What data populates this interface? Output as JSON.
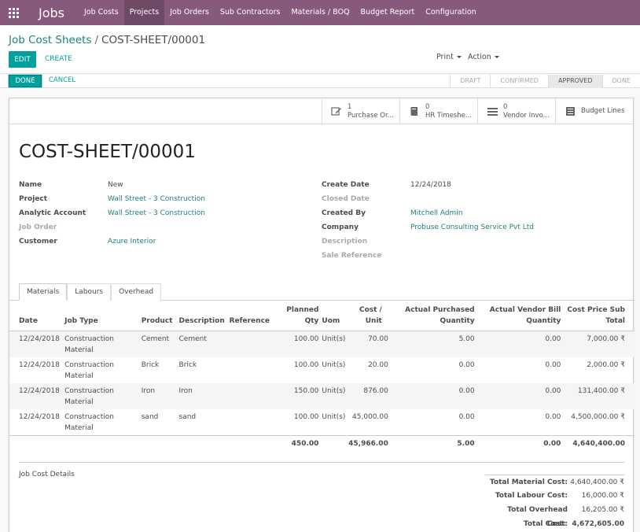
{
  "navbar": {
    "app_title": "Jobs",
    "menu": [
      "Job Costs",
      "Projects",
      "Job Orders",
      "Sub Contractors",
      "Materials / BOQ",
      "Budget Report",
      "Configuration"
    ],
    "active_menu": "Projects"
  },
  "control_panel": {
    "breadcrumb_parent": "Job Cost Sheets",
    "breadcrumb_separator": "/",
    "breadcrumb_current": "COST-SHEET/00001",
    "edit_label": "EDIT",
    "create_label": "CREATE",
    "print_label": "Print",
    "action_label": "Action"
  },
  "statusbar": {
    "done_label": "DONE",
    "cancel_label": "CANCEL",
    "stages": [
      "DRAFT",
      "CONFIRMED",
      "APPROVED",
      "DONE"
    ],
    "active_stage": "APPROVED"
  },
  "smart_buttons": [
    {
      "count": "1",
      "label": "Purchase Or...",
      "icon": "edit-icon"
    },
    {
      "count": "0",
      "label": "HR Timeshe...",
      "icon": "book-icon"
    },
    {
      "count": "0",
      "label": "Vendor Invo...",
      "icon": "list-icon"
    },
    {
      "count": "",
      "label": "Budget Lines",
      "icon": "ledger-icon"
    }
  ],
  "form": {
    "title": "COST-SHEET/00001",
    "left_fields": [
      {
        "label": "Name",
        "value": "New"
      },
      {
        "label": "Project",
        "value": "Wall Street - 3 Construction"
      },
      {
        "label": "Analytic Account",
        "value": "Wall Street - 3 Construction"
      },
      {
        "label": "Job Order",
        "value": ""
      },
      {
        "label": "Customer",
        "value": "Azure Interior"
      }
    ],
    "right_fields": [
      {
        "label": "Create Date",
        "value": "12/24/2018"
      },
      {
        "label": "Closed Date",
        "value": ""
      },
      {
        "label": "Created By",
        "value": "Mitchell Admin"
      },
      {
        "label": "Company",
        "value": "Probuse Consulting Service Pvt Ltd"
      },
      {
        "label": "Description",
        "value": ""
      },
      {
        "label": "Sale Reference",
        "value": ""
      }
    ]
  },
  "tabs": [
    "Materials",
    "Labours",
    "Overhead"
  ],
  "active_tab": "Materials",
  "lines": {
    "headers": {
      "date": "Date",
      "job_type": "Job Type",
      "product": "Product",
      "description": "Description",
      "reference": "Reference",
      "planned_qty_1": "Planned",
      "planned_qty_2": "Qty",
      "uom": "Uom",
      "cost_unit_1": "Cost /",
      "cost_unit_2": "Unit",
      "actual_purchased_1": "Actual Purchased",
      "actual_purchased_2": "Quantity",
      "actual_vendor_1": "Actual Vendor Bill",
      "actual_vendor_2": "Quantity",
      "subtotal_1": "Cost Price Sub",
      "subtotal_2": "Total"
    },
    "rows": [
      {
        "date": "12/24/2018",
        "job_type_1": "Construaction",
        "job_type_2": "Material",
        "product": "Cement",
        "description": "Cement",
        "reference": "",
        "planned_qty": "100.00",
        "uom": "Unit(s)",
        "cost_unit": "70.00",
        "actual_purchased": "5.00",
        "actual_vendor": "0.00",
        "subtotal": "7,000.00 ₹"
      },
      {
        "date": "12/24/2018",
        "job_type_1": "Construaction",
        "job_type_2": "Material",
        "product": "Brick",
        "description": "Brick",
        "reference": "",
        "planned_qty": "100.00",
        "uom": "Unit(s)",
        "cost_unit": "20.00",
        "actual_purchased": "0.00",
        "actual_vendor": "0.00",
        "subtotal": "2,000.00 ₹"
      },
      {
        "date": "12/24/2018",
        "job_type_1": "Construaction",
        "job_type_2": "Material",
        "product": "Iron",
        "description": "Iron",
        "reference": "",
        "planned_qty": "150.00",
        "uom": "Unit(s)",
        "cost_unit": "876.00",
        "actual_purchased": "0.00",
        "actual_vendor": "0.00",
        "subtotal": "131,400.00 ₹"
      },
      {
        "date": "12/24/2018",
        "job_type_1": "Construaction",
        "job_type_2": "Material",
        "product": "sand",
        "description": "sand",
        "reference": "",
        "planned_qty": "100.00",
        "uom": "Unit(s)",
        "cost_unit": "45,000.00",
        "actual_purchased": "0.00",
        "actual_vendor": "0.00",
        "subtotal": "4,500,000.00 ₹"
      }
    ],
    "totals": {
      "planned_qty": "450.00",
      "cost_unit": "45,966.00",
      "actual_purchased": "5.00",
      "actual_vendor": "0.00",
      "subtotal": "4,640,400.00"
    }
  },
  "details": {
    "label": "Job Cost Details",
    "totals": [
      {
        "label": "Total Material Cost:",
        "value": "4,640,400.00 ₹"
      },
      {
        "label": "Total Labour Cost:",
        "value": "16,000.00 ₹"
      },
      {
        "label": "Total Overhead Cost:",
        "value": "16,205.00 ₹"
      },
      {
        "label": "Total Cost:",
        "value": "4,672,605.00 ₹"
      }
    ]
  },
  "colors": {
    "brand": "#875a7b",
    "accent": "#00a09d",
    "link": "#21817e"
  }
}
